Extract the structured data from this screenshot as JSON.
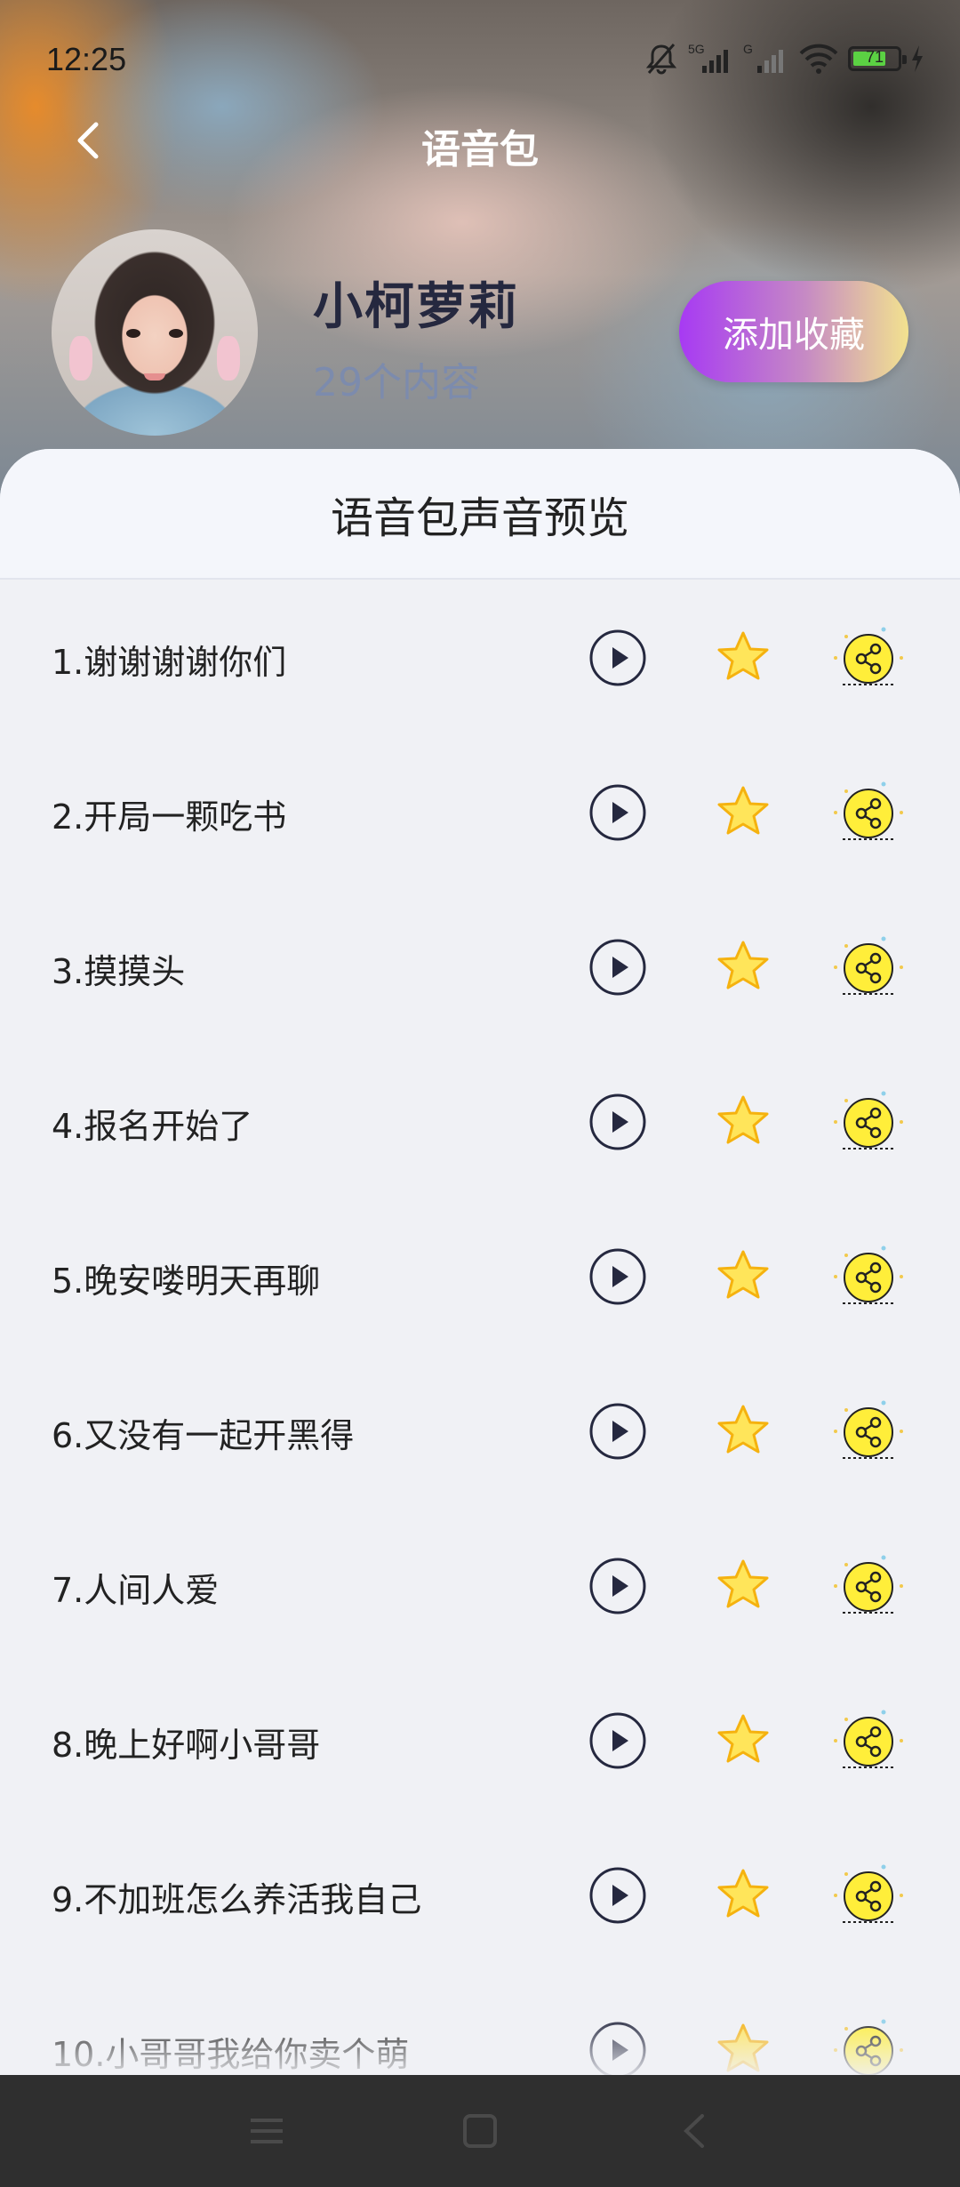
{
  "status_bar": {
    "time": "12:25",
    "network_label": "5G",
    "network2_label": "G",
    "battery_level": "71",
    "icons": [
      "bell-off-icon",
      "signal-icon",
      "signal-icon",
      "wifi-icon",
      "battery-icon",
      "charging-icon"
    ]
  },
  "header": {
    "title": "语音包",
    "back_icon": "chevron-left-icon"
  },
  "profile": {
    "name": "小柯萝莉",
    "count_text": "29个内容",
    "favorite_button": "添加收藏"
  },
  "sheet": {
    "title": "语音包声音预览"
  },
  "clips": [
    {
      "label": "1.谢谢谢谢你们"
    },
    {
      "label": "2.开局一颗吃书"
    },
    {
      "label": "3.摸摸头"
    },
    {
      "label": "4.报名开始了"
    },
    {
      "label": "5.晚安喽明天再聊"
    },
    {
      "label": "6.又没有一起开黑得"
    },
    {
      "label": "7.人间人爱"
    },
    {
      "label": "8.晚上好啊小哥哥"
    },
    {
      "label": "9.不加班怎么养活我自己"
    },
    {
      "label": "10.小哥哥我给你卖个萌"
    }
  ],
  "row_icons": {
    "play": "play-icon",
    "favorite": "star-icon",
    "share": "share-icon"
  },
  "colors": {
    "accent_gradient_start": "#a73af3",
    "accent_gradient_end": "#f2e28f",
    "star_fill": "#ffe55a",
    "star_stroke": "#f5b20f",
    "share_fill": "#ffee3a",
    "text_dark": "#25283f",
    "count_text": "#7c8bad"
  },
  "nav_bar": {
    "items": [
      "menu-icon",
      "home-square-icon",
      "back-triangle-icon"
    ]
  }
}
